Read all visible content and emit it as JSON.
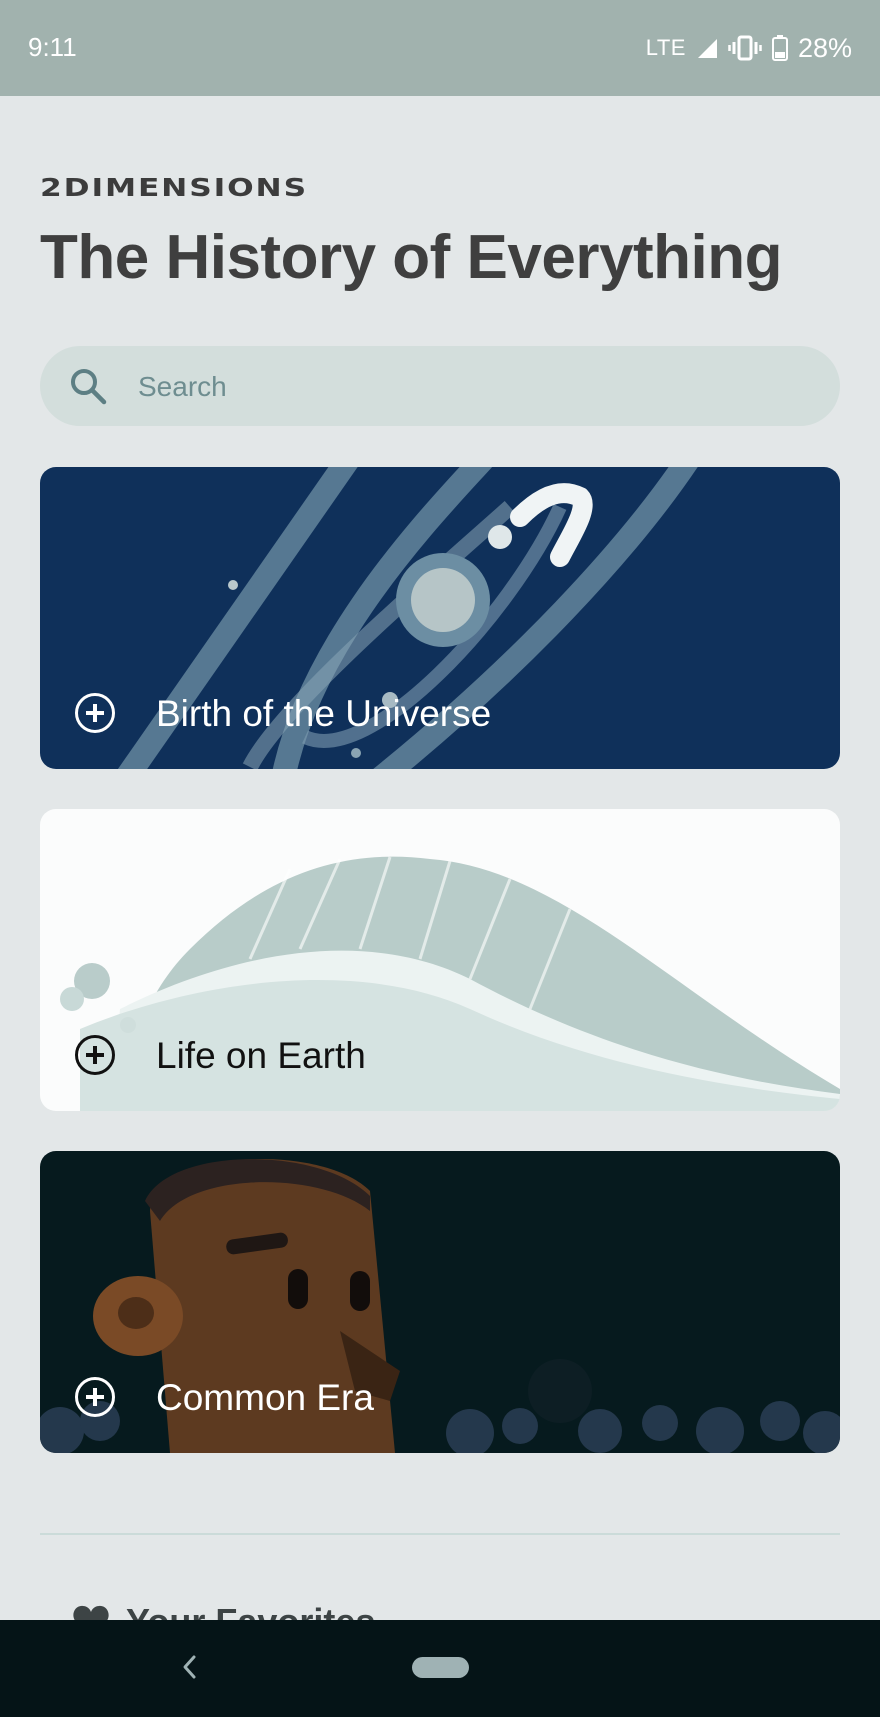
{
  "status_bar": {
    "time": "9:11",
    "network": "LTE",
    "battery": "28%"
  },
  "header": {
    "brand": "2DIMENSIONS",
    "title": "The History of Everything"
  },
  "search": {
    "placeholder": "Search",
    "icon": "search-icon"
  },
  "eras": [
    {
      "label": "Birth of the Universe",
      "icon": "plus-circle-icon",
      "bg": "#0f305a",
      "text_color": "#ffffff"
    },
    {
      "label": "Life on Earth",
      "icon": "plus-circle-icon",
      "bg": "#fbfcfc",
      "text_color": "#111111"
    },
    {
      "label": "Common Era",
      "icon": "plus-circle-icon",
      "bg": "#061a1e",
      "text_color": "#ffffff"
    }
  ],
  "favorites": {
    "label": "Your Favorites",
    "icon": "heart-icon"
  },
  "navigation": {
    "back_icon": "back-chevron-icon",
    "home_icon": "home-pill-icon"
  },
  "colors": {
    "background": "#e3e7e8",
    "status_bar": "#a1b2ae",
    "search_bg": "#d3dedc",
    "nav_bar": "#051417"
  }
}
